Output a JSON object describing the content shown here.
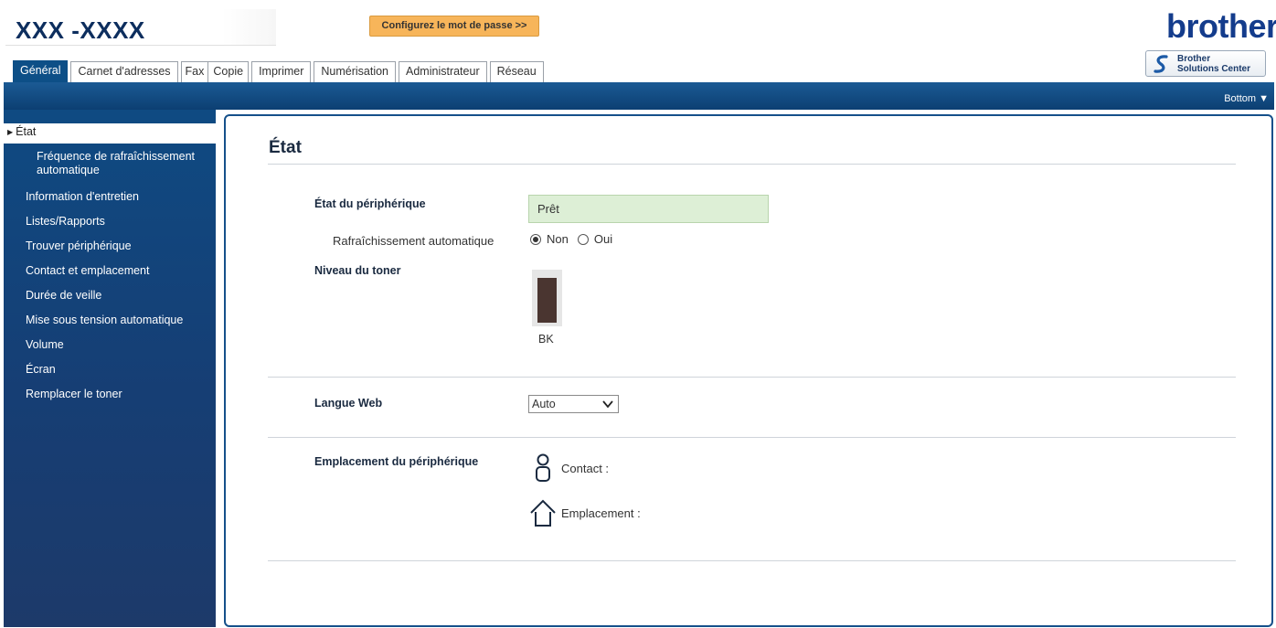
{
  "header": {
    "model_name": "XXX -XXXX",
    "password_button": "Configurez le mot de passe >>",
    "brand": "brother",
    "solutions_center": {
      "line1": "Brother",
      "line2": "Solutions Center"
    }
  },
  "tabs": [
    {
      "label": "Général",
      "active": true
    },
    {
      "label": "Carnet d'adresses"
    },
    {
      "label": "Fax"
    },
    {
      "label": "Copie"
    },
    {
      "label": "Imprimer"
    },
    {
      "label": "Numérisation"
    },
    {
      "label": "Administrateur"
    },
    {
      "label": "Réseau"
    }
  ],
  "band": {
    "bottom_link": "Bottom ▼"
  },
  "sidebar": {
    "items": [
      {
        "label": "État",
        "active": true
      },
      {
        "label": "Fréquence de rafraîchissement",
        "label2": "automatique",
        "sub": true
      },
      {
        "label": "Information d'entretien"
      },
      {
        "label": "Listes/Rapports"
      },
      {
        "label": "Trouver périphérique"
      },
      {
        "label": "Contact et emplacement"
      },
      {
        "label": "Durée de veille"
      },
      {
        "label": "Mise sous tension automatique"
      },
      {
        "label": "Volume"
      },
      {
        "label": "Écran"
      },
      {
        "label": "Remplacer le toner"
      }
    ]
  },
  "main": {
    "title": "État",
    "device_status_label": "État du périphérique",
    "device_status_value": "Prêt",
    "auto_refresh_label": "Rafraîchissement automatique",
    "auto_refresh_options": [
      "Non",
      "Oui"
    ],
    "auto_refresh_selected": "Non",
    "toner_label": "Niveau du toner",
    "toner": {
      "name": "BK",
      "level_fraction": 0.9,
      "color": "#4a3530"
    },
    "web_language_label": "Langue Web",
    "web_language_value": "Auto",
    "device_location_label": "Emplacement du périphérique",
    "contact_label": "Contact :",
    "location_label": "Emplacement :"
  }
}
